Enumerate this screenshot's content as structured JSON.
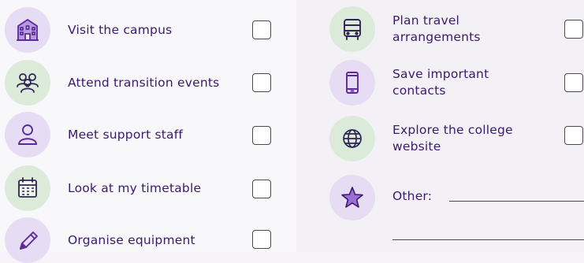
{
  "left_items": [
    {
      "label": "Visit the campus",
      "icon": "building-icon",
      "checked": false
    },
    {
      "label": "Attend transition events",
      "icon": "people-group-icon",
      "checked": false
    },
    {
      "label": "Meet support staff",
      "icon": "person-icon",
      "checked": false
    },
    {
      "label": "Look at my timetable",
      "icon": "calendar-icon",
      "checked": false
    },
    {
      "label": "Organise equipment",
      "icon": "pencil-icon",
      "checked": false
    }
  ],
  "right_items": [
    {
      "label_line1": "Plan travel",
      "label_line2": "arrangements",
      "icon": "bus-icon",
      "checked": false
    },
    {
      "label_line1": "Save important",
      "label_line2": "contacts",
      "icon": "phone-icon",
      "checked": false
    },
    {
      "label_line1": "Explore the college",
      "label_line2": "website",
      "icon": "globe-icon",
      "checked": false
    }
  ],
  "other": {
    "label": "Other:",
    "icon": "star-icon"
  },
  "colors": {
    "accent": "#3a1a6e",
    "purple_circle": "#e6dcf3",
    "green_circle": "#dcebd9"
  }
}
